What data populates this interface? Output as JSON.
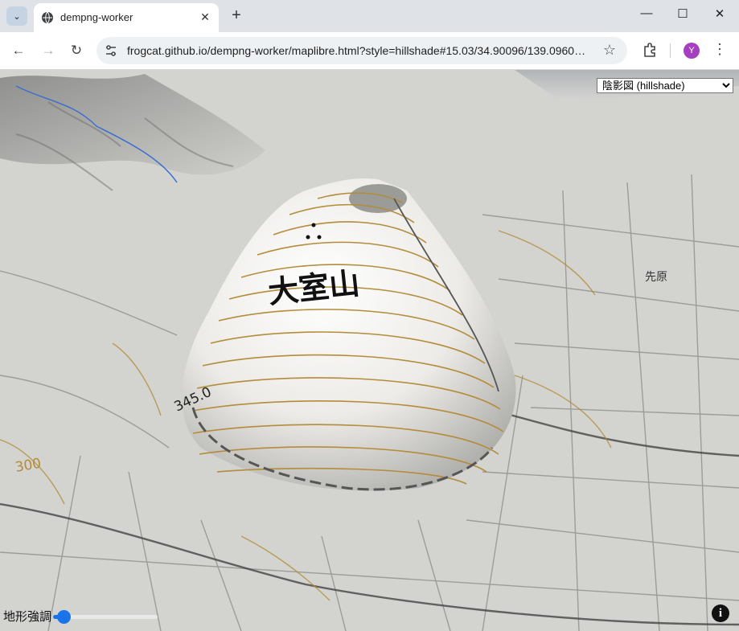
{
  "browser": {
    "tab_title": "dempng-worker",
    "url": "frogcat.github.io/dempng-worker/maplibre.html?style=hillshade#15.03/34.90096/139.0960…",
    "profile_initial": "Y",
    "icons": {
      "tab_search": "chevron-down-icon",
      "favicon": "globe-icon",
      "tab_close": "close-icon",
      "new_tab": "plus-icon",
      "minimize": "minimize-icon",
      "maximize": "maximize-icon",
      "close_window": "close-icon",
      "back": "back-arrow-icon",
      "forward": "forward-arrow-icon",
      "reload": "reload-icon",
      "site_info": "tune-icon",
      "bookmark": "star-icon",
      "extensions": "puzzle-icon",
      "menu": "kebab-menu-icon"
    },
    "glyphs": {
      "tab_search": "⌄",
      "tab_close": "✕",
      "new_tab": "+",
      "minimize": "—",
      "maximize": "☐",
      "close_window": "✕",
      "back": "←",
      "forward": "→",
      "reload": "↻",
      "bookmark": "☆",
      "menu": "⋮"
    }
  },
  "map": {
    "style_select": {
      "selected": "陰影図 (hillshade)"
    },
    "labels": {
      "mountain": "大室山",
      "elevation": "345.0",
      "contour": "300",
      "place": "先原"
    },
    "relief_control": {
      "label": "地形強調",
      "value": 0.1
    },
    "info_button": "i",
    "colors": {
      "contour": "#b48c3a",
      "water": "#3a6fd0",
      "road": "#555555"
    }
  }
}
